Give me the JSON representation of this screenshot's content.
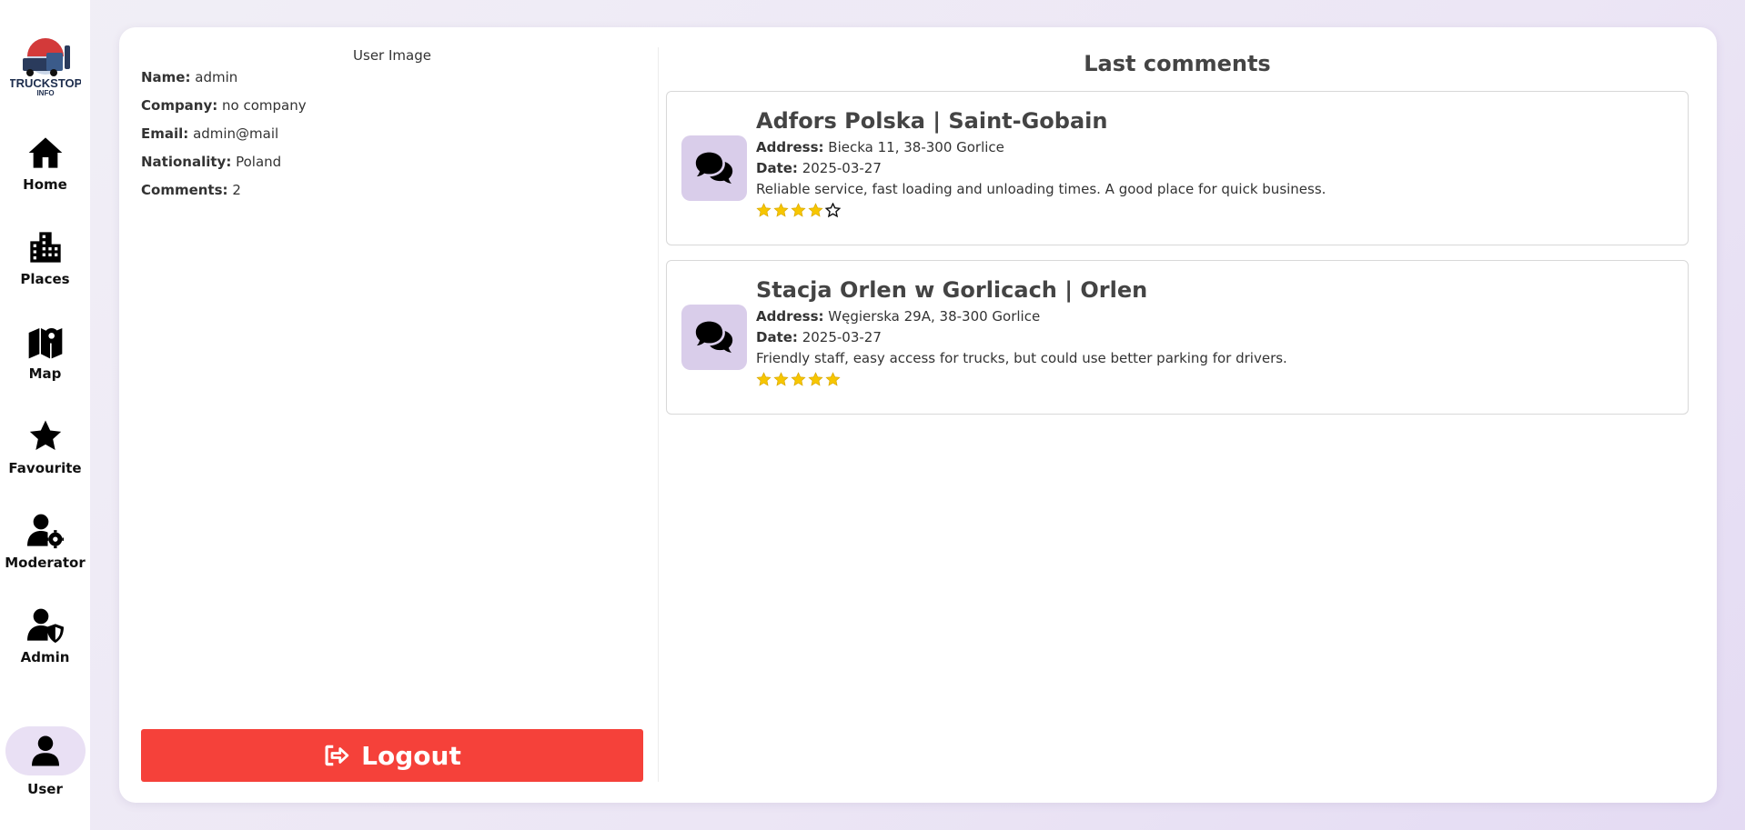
{
  "sidebar": {
    "logo_text": "TRUCKSTOP INFO",
    "items": [
      {
        "label": "Home",
        "icon": "home-icon"
      },
      {
        "label": "Places",
        "icon": "city-icon"
      },
      {
        "label": "Map",
        "icon": "map-icon"
      },
      {
        "label": "Favourite",
        "icon": "star-icon"
      },
      {
        "label": "Moderator",
        "icon": "user-gear-icon"
      },
      {
        "label": "Admin",
        "icon": "user-shield-icon"
      }
    ],
    "user": {
      "label": "User",
      "icon": "user-icon"
    }
  },
  "profile": {
    "image_alt": "User Image",
    "fields": [
      {
        "label": "Name:",
        "value": "admin"
      },
      {
        "label": "Company:",
        "value": "no company"
      },
      {
        "label": "Email:",
        "value": "admin@mail"
      },
      {
        "label": "Nationality:",
        "value": "Poland"
      },
      {
        "label": "Comments:",
        "value": "2"
      }
    ],
    "logout_label": "Logout"
  },
  "comments": {
    "title": "Last comments",
    "address_label": "Address:",
    "date_label": "Date:",
    "items": [
      {
        "place": "Adfors Polska | Saint-Gobain",
        "address": "Biecka 11, 38-300 Gorlice",
        "date": "2025-03-27",
        "text": "Reliable service, fast loading and unloading times. A good place for quick business.",
        "rating": 4,
        "max_rating": 5
      },
      {
        "place": "Stacja Orlen w Gorlicach | Orlen",
        "address": "Węgierska 29A, 38-300 Gorlice",
        "date": "2025-03-27",
        "text": "Friendly staff, easy access for trucks, but could use better parking for drivers.",
        "rating": 5,
        "max_rating": 5
      }
    ]
  },
  "colors": {
    "accent": "#f5413a",
    "icon_bg": "#d9cdea",
    "star": "#f7c600"
  }
}
